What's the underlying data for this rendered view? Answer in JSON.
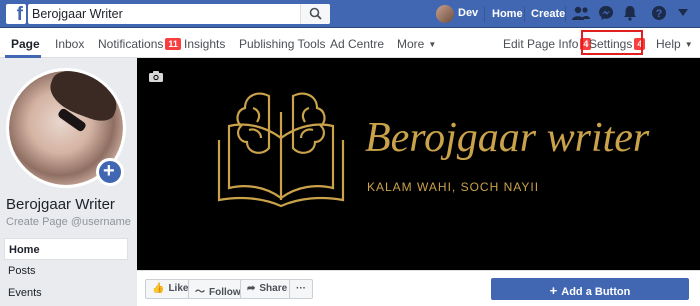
{
  "topbar": {
    "search_value": "Berojgaar Writer",
    "user_name": "Dev",
    "home_label": "Home",
    "create_label": "Create"
  },
  "pagenav": {
    "items": [
      {
        "label": "Page"
      },
      {
        "label": "Inbox"
      },
      {
        "label": "Notifications",
        "badge": "11"
      },
      {
        "label": "Insights"
      },
      {
        "label": "Publishing Tools"
      },
      {
        "label": "Ad Centre"
      },
      {
        "label": "More"
      },
      {
        "label": "Edit Page Info",
        "badge": "4"
      },
      {
        "label": "Settings",
        "badge": "4"
      },
      {
        "label": "Help"
      }
    ]
  },
  "profile": {
    "page_name": "Berojgaar Writer",
    "username_link": "Create Page @username"
  },
  "left_menu": [
    "Home",
    "Posts",
    "Events"
  ],
  "cover": {
    "title": "Berojgaar writer",
    "subtitle": "KALAM WAHI, SOCH NAYII"
  },
  "actions": {
    "like": "Like",
    "follow": "Follow",
    "share": "Share",
    "more": "···",
    "add_button": "Add a Button"
  },
  "colors": {
    "facebook_blue": "#4267b2",
    "badge_red": "#fa3e3e",
    "cover_gold": "#c9a24a",
    "highlight_red": "#e02020"
  }
}
